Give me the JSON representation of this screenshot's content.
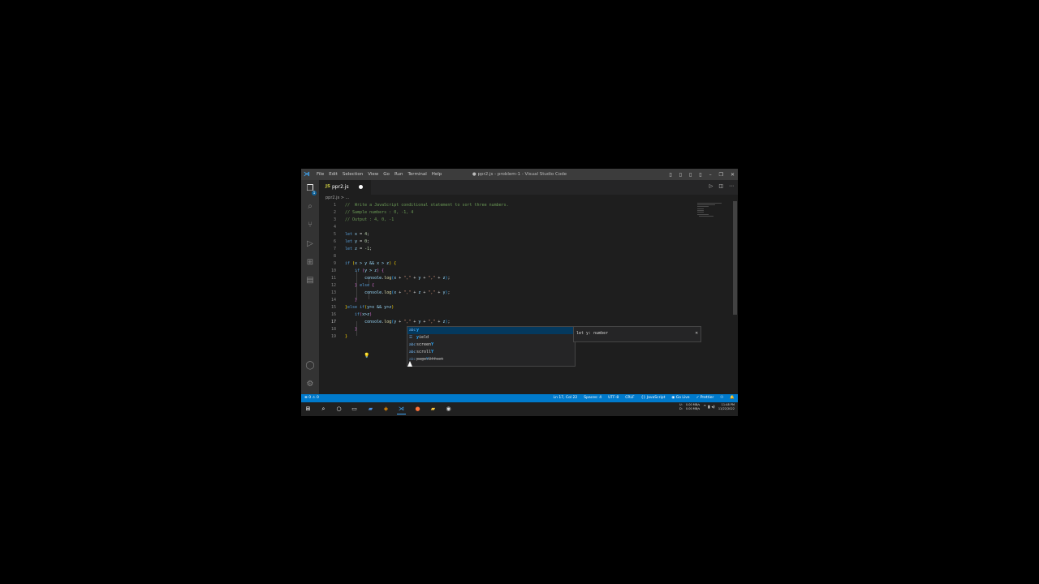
{
  "titlebar": {
    "menus": [
      "File",
      "Edit",
      "Selection",
      "View",
      "Go",
      "Run",
      "Terminal",
      "Help"
    ],
    "title": "● ppr2.js - problem-1 - Visual Studio Code",
    "controls": [
      "layout-icon",
      "layout-icon",
      "layout-icon",
      "layout-icon",
      "minimize-icon",
      "restore-icon",
      "close-icon"
    ],
    "control_glyphs": [
      "▯",
      "▯",
      "▯",
      "▯",
      "–",
      "❐",
      "✕"
    ]
  },
  "activity_bar": {
    "items": [
      "explorer-icon",
      "search-icon",
      "source-control-icon",
      "run-debug-icon",
      "extensions-icon",
      "testing-icon",
      "account-icon",
      "settings-gear-icon"
    ],
    "glyphs": [
      "❐",
      "⌕",
      "⑂",
      "▷",
      "⊞",
      "▤",
      "◯",
      "⚙"
    ],
    "explorer_badge": "1"
  },
  "tab": {
    "lang_badge": "JS",
    "name": "ppr2.js"
  },
  "tab_actions": {
    "glyphs": [
      "▷",
      "◫",
      "⋯"
    ]
  },
  "breadcrumb": "ppr2.js > ...",
  "editor": {
    "line_numbers": [
      "1",
      "2",
      "3",
      "4",
      "5",
      "6",
      "7",
      "8",
      "9",
      "10",
      "11",
      "12",
      "13",
      "14",
      "15",
      "16",
      "17",
      "18",
      "19"
    ],
    "current_line": "17"
  },
  "suggest": {
    "items": [
      {
        "icon": "abc",
        "pre": "",
        "hl": "y",
        "post": ""
      },
      {
        "icon": "☰",
        "pre": "",
        "hl": "y",
        "post": "ield"
      },
      {
        "icon": "abc",
        "pre": "screen",
        "hl": "Y",
        "post": ""
      },
      {
        "icon": "abc",
        "pre": "scroll",
        "hl": "Y",
        "post": ""
      },
      {
        "icon": "abc",
        "pre": "page",
        "hl": "Y",
        "post": "Offset"
      }
    ],
    "detail": "let y: number",
    "close_glyph": "✕"
  },
  "statusbar": {
    "left": "⊗ 0 ⚠ 0",
    "right": [
      "Ln 17, Col 22",
      "Spaces: 4",
      "UTF-8",
      "CRLF",
      "{} JavaScript",
      "◉ Go Live",
      "✓ Prettier",
      "⚇",
      "🔔"
    ]
  },
  "taskbar": {
    "apps": [
      "windows-start-icon",
      "taskbar-search-icon",
      "cortana-icon",
      "task-view-icon",
      "mail-icon",
      "sublime-icon",
      "vscode-icon",
      "firefox-icon",
      "file-explorer-icon",
      "github-icon"
    ],
    "glyphs": [
      "⊞",
      "⌕",
      "○",
      "▭",
      "▰",
      "◈",
      "⋊",
      "●",
      "▰",
      "◉"
    ],
    "colors": [
      "#ffffff",
      "#ffffff",
      "#ffffff",
      "#dddddd",
      "#4a90e2",
      "#ff9800",
      "#3ea6f5",
      "#ff7139",
      "#f4c542",
      "#dddddd"
    ],
    "tray_labels": [
      "U:",
      "D:"
    ],
    "tray_speeds": [
      "0.00 MB/s",
      "0.00 MB/s"
    ],
    "tray_icons": "^ ▮ ◂)",
    "time": "11:48 PM",
    "date": "11/22/2022"
  },
  "colors": {
    "accent": "#007acc",
    "selection": "#04395e",
    "titlebar": "#3c3c3c",
    "activitybar": "#333333"
  }
}
